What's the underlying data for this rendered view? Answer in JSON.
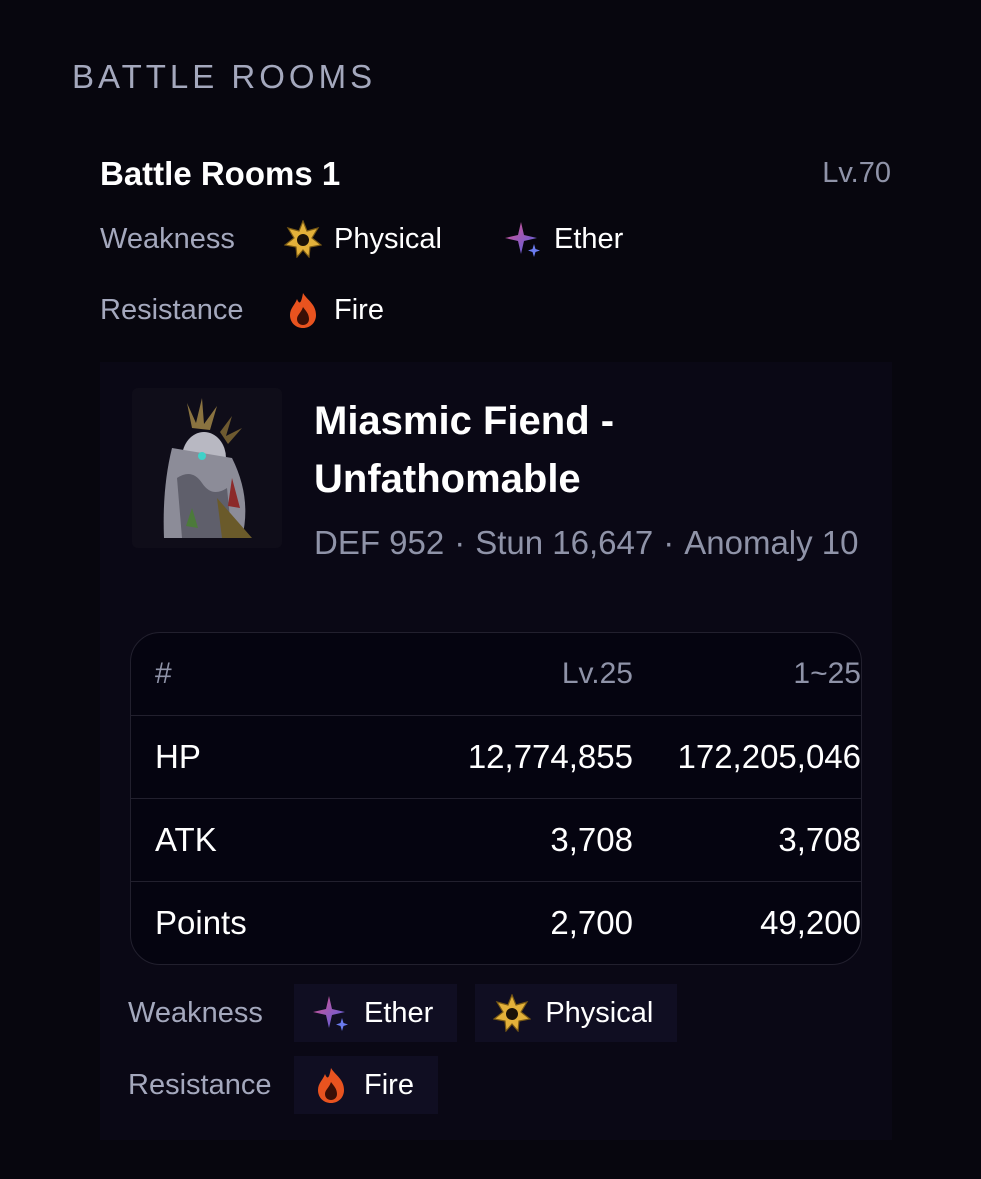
{
  "section": {
    "heading": "BATTLE ROOMS"
  },
  "room": {
    "title": "Battle Rooms 1",
    "level": "Lv.70",
    "weakness_label": "Weakness",
    "resistance_label": "Resistance",
    "weaknesses": [
      {
        "name": "Physical",
        "icon": "physical-icon"
      },
      {
        "name": "Ether",
        "icon": "ether-icon"
      }
    ],
    "resistances": [
      {
        "name": "Fire",
        "icon": "fire-icon"
      }
    ]
  },
  "enemy": {
    "name": "Miasmic Fiend - Unfathomable",
    "portrait_icon": "enemy-portrait",
    "def": "DEF 952",
    "stun": "Stun 16,647",
    "anomaly": "Anomaly 10",
    "separator": "·",
    "table": {
      "headers": [
        "#",
        "Lv.25",
        "1~25"
      ],
      "rows": [
        [
          "HP",
          "12,774,855",
          "172,205,046"
        ],
        [
          "ATK",
          "3,708",
          "3,708"
        ],
        [
          "Points",
          "2,700",
          "49,200"
        ]
      ]
    },
    "weakness_label": "Weakness",
    "resistance_label": "Resistance",
    "weaknesses": [
      {
        "name": "Ether",
        "icon": "ether-icon"
      },
      {
        "name": "Physical",
        "icon": "physical-icon"
      }
    ],
    "resistances": [
      {
        "name": "Fire",
        "icon": "fire-icon"
      }
    ]
  },
  "colors": {
    "background": "#07060e",
    "card": "#0a0815",
    "muted_text": "#8f93a8",
    "physical": "#e3b13a",
    "ether_pink": "#e0508a",
    "ether_blue": "#4c62e8",
    "fire": "#e8531f"
  }
}
